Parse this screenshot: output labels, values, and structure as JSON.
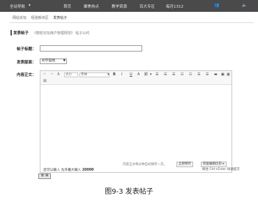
{
  "topbar": {
    "nav": [
      "全站导航",
      "首页",
      "聚焦热点",
      "教学资源",
      "百大专区",
      "每月1312"
    ],
    "tools": [
      "用户",
      "消息"
    ]
  },
  "breadcrumb": [
    "网站论坛",
    "经验板块区",
    "发表帖子"
  ],
  "section": {
    "title": "发表帖子",
    "tip": "《德宏论坛用户管理规范》 帖子公约"
  },
  "form": {
    "title_label": "帖子标题：",
    "title_value": "",
    "board_label": "发表版面：",
    "board_selected": "初学园地",
    "content_label": "内容正文："
  },
  "editor": {
    "toolbar": {
      "undo": "↶",
      "redo": "↷",
      "clear": "♁",
      "font_size": "大小",
      "font_family": "字体",
      "bold": "B",
      "italic": "I",
      "underline": "U",
      "strike": "A",
      "color": "颜",
      "more": "▾"
    },
    "autosave_text": "内容正文每分钟自动保存一次。",
    "save_btn": "立即保存",
    "restore_btn": "恢复编辑历史 ▸"
  },
  "footer": {
    "count_prefix": "还可以输入 允许最大输入",
    "count_value": "20000",
    "hint": "按住 Ctrl+Enter 快速提交",
    "submit": "发 表"
  },
  "caption": "图9-3  发表帖子",
  "colors": {
    "topbar": "#4a4a4a",
    "border": "#999999"
  }
}
